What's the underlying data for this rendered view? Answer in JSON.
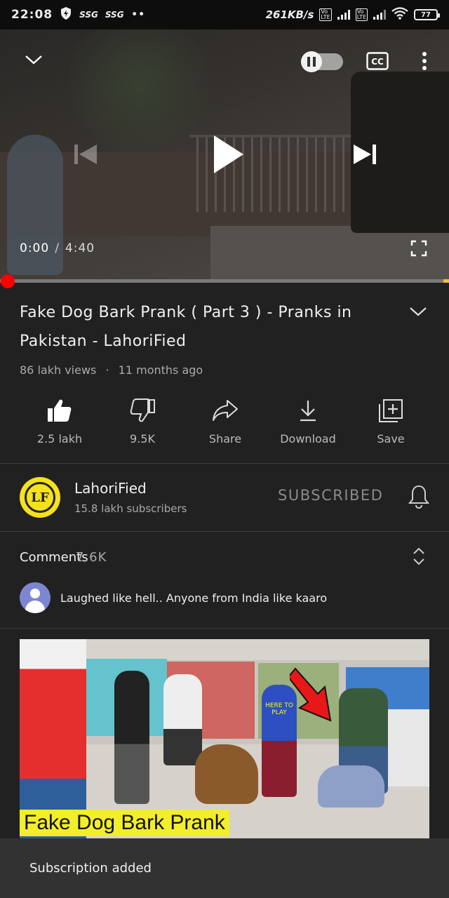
{
  "status_bar": {
    "time": "22:08",
    "sim1": "SSG",
    "sim2": "SSG",
    "dots": "••",
    "speed": "261KB/s",
    "battery": "77",
    "icons": [
      "shield-icon",
      "signal-icon",
      "wifi-icon",
      "battery-icon"
    ]
  },
  "player": {
    "current_time": "0:00",
    "separator": "/",
    "duration": "4:40",
    "progress_fraction": 0.0,
    "autoplay_on": false,
    "icons": [
      "chevron-down-icon",
      "autoplay-toggle-icon",
      "cc-icon",
      "more-vert-icon",
      "previous-icon",
      "play-icon",
      "next-icon",
      "fullscreen-icon"
    ]
  },
  "video": {
    "title": "Fake Dog Bark Prank ( Part 3 ) - Pranks in Pakistan - LahoriFied",
    "views": "86 lakh views",
    "meta_separator": "·",
    "age": "11 months ago"
  },
  "actions": [
    {
      "name": "like",
      "label": "2.5 lakh",
      "icon": "thumbs-up-icon"
    },
    {
      "name": "dislike",
      "label": "9.5K",
      "icon": "thumbs-down-icon"
    },
    {
      "name": "share",
      "label": "Share",
      "icon": "share-icon"
    },
    {
      "name": "download",
      "label": "Download",
      "icon": "download-icon"
    },
    {
      "name": "save",
      "label": "Save",
      "icon": "playlist-add-icon"
    }
  ],
  "channel": {
    "avatar_text": "LF",
    "name": "LahoriFied",
    "subscribers": "15.8 lakh subscribers",
    "subscribe_label": "SUBSCRIBED"
  },
  "comments": {
    "label": "Comments",
    "count": "7.6K",
    "top_comment": "Laughed like hell.. Anyone from India like kaaro"
  },
  "next_video": {
    "caption": "Fake Dog Bark Prank",
    "shirt_text": "HERE TO PLAY"
  },
  "snackbar": {
    "message": "Subscription added"
  },
  "colors": {
    "background": "#212121",
    "accent_red": "#ff0000",
    "caption_yellow": "#f2ee2a",
    "channel_yellow": "#f5e21c"
  }
}
